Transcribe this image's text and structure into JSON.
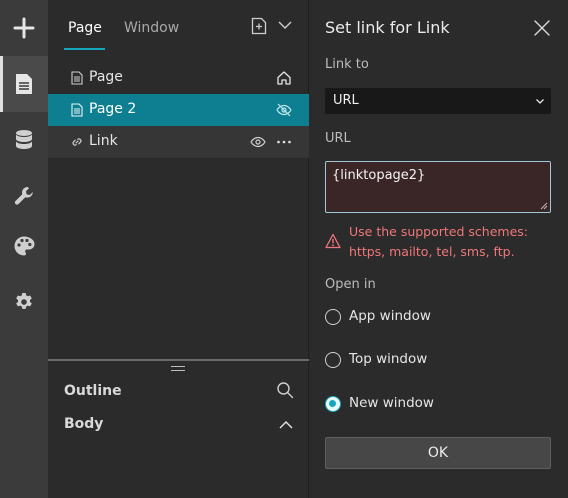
{
  "left_panel": {
    "tabs": [
      {
        "label": "Page"
      },
      {
        "label": "Window"
      }
    ],
    "pages": [
      {
        "label": "Page",
        "icon": "page-icon",
        "right_icon": "home-icon"
      },
      {
        "label": "Page 2",
        "icon": "page-icon",
        "right_icon": "eye-hidden-icon"
      },
      {
        "label": "Link",
        "icon": "link-icon",
        "right_icon": "eye-icon"
      }
    ],
    "outline_title": "Outline",
    "body_title": "Body"
  },
  "dialog": {
    "title": "Set link for Link",
    "link_to_label": "Link to",
    "link_to_value": "URL",
    "url_label": "URL",
    "url_value": "{linktopage2}",
    "error_message": "Use the supported schemes: https, mailto, tel, sms, ftp.",
    "open_in_label": "Open in",
    "open_in_options": [
      {
        "label": "App window",
        "checked": false
      },
      {
        "label": "Top window",
        "checked": false
      },
      {
        "label": "New window",
        "checked": true
      }
    ],
    "ok_label": "OK"
  },
  "colors": {
    "accent": "#14a7bc",
    "selected_row": "#0e7f91",
    "error": "#f0777a",
    "panel_bg": "#2b2b2b",
    "rail_bg": "#3b3b3b"
  }
}
